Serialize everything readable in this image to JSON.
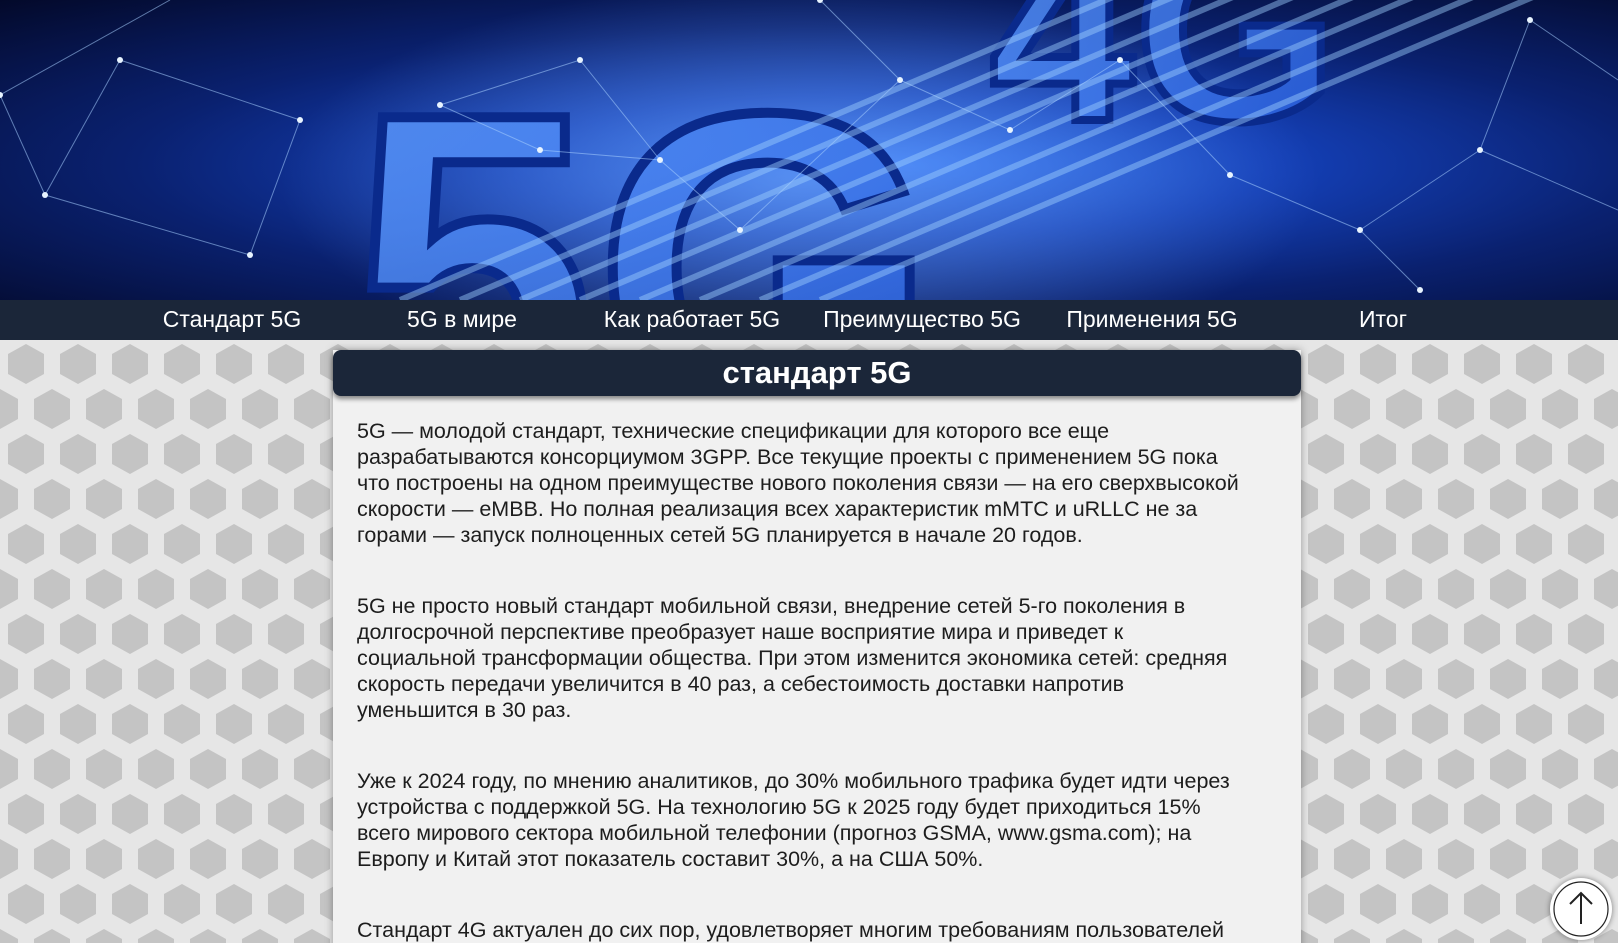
{
  "hero": {
    "image_icon": "5g-network-banner-image",
    "accent_color": "#2a6cf0"
  },
  "nav": {
    "items": [
      {
        "label": "Стандарт 5G"
      },
      {
        "label": "5G в мире"
      },
      {
        "label": "Как работает 5G"
      },
      {
        "label": "Преимущество 5G"
      },
      {
        "label": "Применения 5G"
      },
      {
        "label": "Итог"
      }
    ],
    "background_color": "#1b2639"
  },
  "section": {
    "title": "стандарт 5G",
    "paragraphs": [
      {
        "lines": [
          "5G — молодой стандарт, технические спецификации для которого все еще",
          "разрабатываются консорциумом 3GPP. Все текущие проекты с применением 5G пока",
          "что построены на одном преимуществе нового поколения связи — на его сверхвысокой",
          "скорости — eMBB. Но полная реализация всех характеристик mMTC и uRLLC не за",
          "горами — запуск полноценных сетей 5G планируется в начале 20 годов."
        ]
      },
      {
        "lines": [
          "5G не просто новый стандарт мобильной связи, внедрение сетей 5-го поколения в",
          "долгосрочной перспективе преобразует наше восприятие мира и приведет к",
          "социальной трансформации общества. При этом изменится экономика сетей: средняя",
          "скорость передачи увеличится в 40 раз, а себестоимость доставки напротив",
          "уменьшится в 30 раз."
        ]
      },
      {
        "lines": [
          "Уже к 2024 году, по мнению аналитиков, до 30% мобильного трафика будет идти через",
          "устройства с поддержкой 5G. На технологию 5G к 2025 году будет приходиться 15%",
          "всего мирового сектора мобильной телефонии (прогноз GSMA, www.gsma.com); на",
          "Европу и Китай этот показатель составит 30%, а на США 50%."
        ]
      },
      {
        "lines": [
          "Стандарт 4G актуален до сих пор, удовлетворяет многим требованиям пользователей"
        ]
      }
    ]
  },
  "scroll_top": {
    "icon": "arrow-up-icon"
  }
}
